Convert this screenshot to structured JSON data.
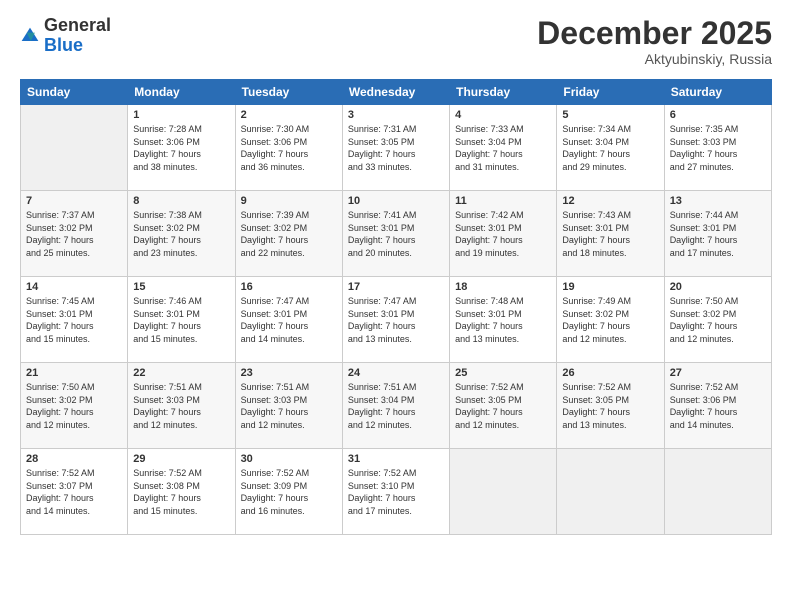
{
  "logo": {
    "general": "General",
    "blue": "Blue"
  },
  "header": {
    "month": "December 2025",
    "location": "Aktyubinskiy, Russia"
  },
  "weekdays": [
    "Sunday",
    "Monday",
    "Tuesday",
    "Wednesday",
    "Thursday",
    "Friday",
    "Saturday"
  ],
  "weeks": [
    [
      {
        "day": "",
        "info": ""
      },
      {
        "day": "1",
        "info": "Sunrise: 7:28 AM\nSunset: 3:06 PM\nDaylight: 7 hours\nand 38 minutes."
      },
      {
        "day": "2",
        "info": "Sunrise: 7:30 AM\nSunset: 3:06 PM\nDaylight: 7 hours\nand 36 minutes."
      },
      {
        "day": "3",
        "info": "Sunrise: 7:31 AM\nSunset: 3:05 PM\nDaylight: 7 hours\nand 33 minutes."
      },
      {
        "day": "4",
        "info": "Sunrise: 7:33 AM\nSunset: 3:04 PM\nDaylight: 7 hours\nand 31 minutes."
      },
      {
        "day": "5",
        "info": "Sunrise: 7:34 AM\nSunset: 3:04 PM\nDaylight: 7 hours\nand 29 minutes."
      },
      {
        "day": "6",
        "info": "Sunrise: 7:35 AM\nSunset: 3:03 PM\nDaylight: 7 hours\nand 27 minutes."
      }
    ],
    [
      {
        "day": "7",
        "info": "Sunrise: 7:37 AM\nSunset: 3:02 PM\nDaylight: 7 hours\nand 25 minutes."
      },
      {
        "day": "8",
        "info": "Sunrise: 7:38 AM\nSunset: 3:02 PM\nDaylight: 7 hours\nand 23 minutes."
      },
      {
        "day": "9",
        "info": "Sunrise: 7:39 AM\nSunset: 3:02 PM\nDaylight: 7 hours\nand 22 minutes."
      },
      {
        "day": "10",
        "info": "Sunrise: 7:41 AM\nSunset: 3:01 PM\nDaylight: 7 hours\nand 20 minutes."
      },
      {
        "day": "11",
        "info": "Sunrise: 7:42 AM\nSunset: 3:01 PM\nDaylight: 7 hours\nand 19 minutes."
      },
      {
        "day": "12",
        "info": "Sunrise: 7:43 AM\nSunset: 3:01 PM\nDaylight: 7 hours\nand 18 minutes."
      },
      {
        "day": "13",
        "info": "Sunrise: 7:44 AM\nSunset: 3:01 PM\nDaylight: 7 hours\nand 17 minutes."
      }
    ],
    [
      {
        "day": "14",
        "info": "Sunrise: 7:45 AM\nSunset: 3:01 PM\nDaylight: 7 hours\nand 15 minutes."
      },
      {
        "day": "15",
        "info": "Sunrise: 7:46 AM\nSunset: 3:01 PM\nDaylight: 7 hours\nand 15 minutes."
      },
      {
        "day": "16",
        "info": "Sunrise: 7:47 AM\nSunset: 3:01 PM\nDaylight: 7 hours\nand 14 minutes."
      },
      {
        "day": "17",
        "info": "Sunrise: 7:47 AM\nSunset: 3:01 PM\nDaylight: 7 hours\nand 13 minutes."
      },
      {
        "day": "18",
        "info": "Sunrise: 7:48 AM\nSunset: 3:01 PM\nDaylight: 7 hours\nand 13 minutes."
      },
      {
        "day": "19",
        "info": "Sunrise: 7:49 AM\nSunset: 3:02 PM\nDaylight: 7 hours\nand 12 minutes."
      },
      {
        "day": "20",
        "info": "Sunrise: 7:50 AM\nSunset: 3:02 PM\nDaylight: 7 hours\nand 12 minutes."
      }
    ],
    [
      {
        "day": "21",
        "info": "Sunrise: 7:50 AM\nSunset: 3:02 PM\nDaylight: 7 hours\nand 12 minutes."
      },
      {
        "day": "22",
        "info": "Sunrise: 7:51 AM\nSunset: 3:03 PM\nDaylight: 7 hours\nand 12 minutes."
      },
      {
        "day": "23",
        "info": "Sunrise: 7:51 AM\nSunset: 3:03 PM\nDaylight: 7 hours\nand 12 minutes."
      },
      {
        "day": "24",
        "info": "Sunrise: 7:51 AM\nSunset: 3:04 PM\nDaylight: 7 hours\nand 12 minutes."
      },
      {
        "day": "25",
        "info": "Sunrise: 7:52 AM\nSunset: 3:05 PM\nDaylight: 7 hours\nand 12 minutes."
      },
      {
        "day": "26",
        "info": "Sunrise: 7:52 AM\nSunset: 3:05 PM\nDaylight: 7 hours\nand 13 minutes."
      },
      {
        "day": "27",
        "info": "Sunrise: 7:52 AM\nSunset: 3:06 PM\nDaylight: 7 hours\nand 14 minutes."
      }
    ],
    [
      {
        "day": "28",
        "info": "Sunrise: 7:52 AM\nSunset: 3:07 PM\nDaylight: 7 hours\nand 14 minutes."
      },
      {
        "day": "29",
        "info": "Sunrise: 7:52 AM\nSunset: 3:08 PM\nDaylight: 7 hours\nand 15 minutes."
      },
      {
        "day": "30",
        "info": "Sunrise: 7:52 AM\nSunset: 3:09 PM\nDaylight: 7 hours\nand 16 minutes."
      },
      {
        "day": "31",
        "info": "Sunrise: 7:52 AM\nSunset: 3:10 PM\nDaylight: 7 hours\nand 17 minutes."
      },
      {
        "day": "",
        "info": ""
      },
      {
        "day": "",
        "info": ""
      },
      {
        "day": "",
        "info": ""
      }
    ]
  ]
}
